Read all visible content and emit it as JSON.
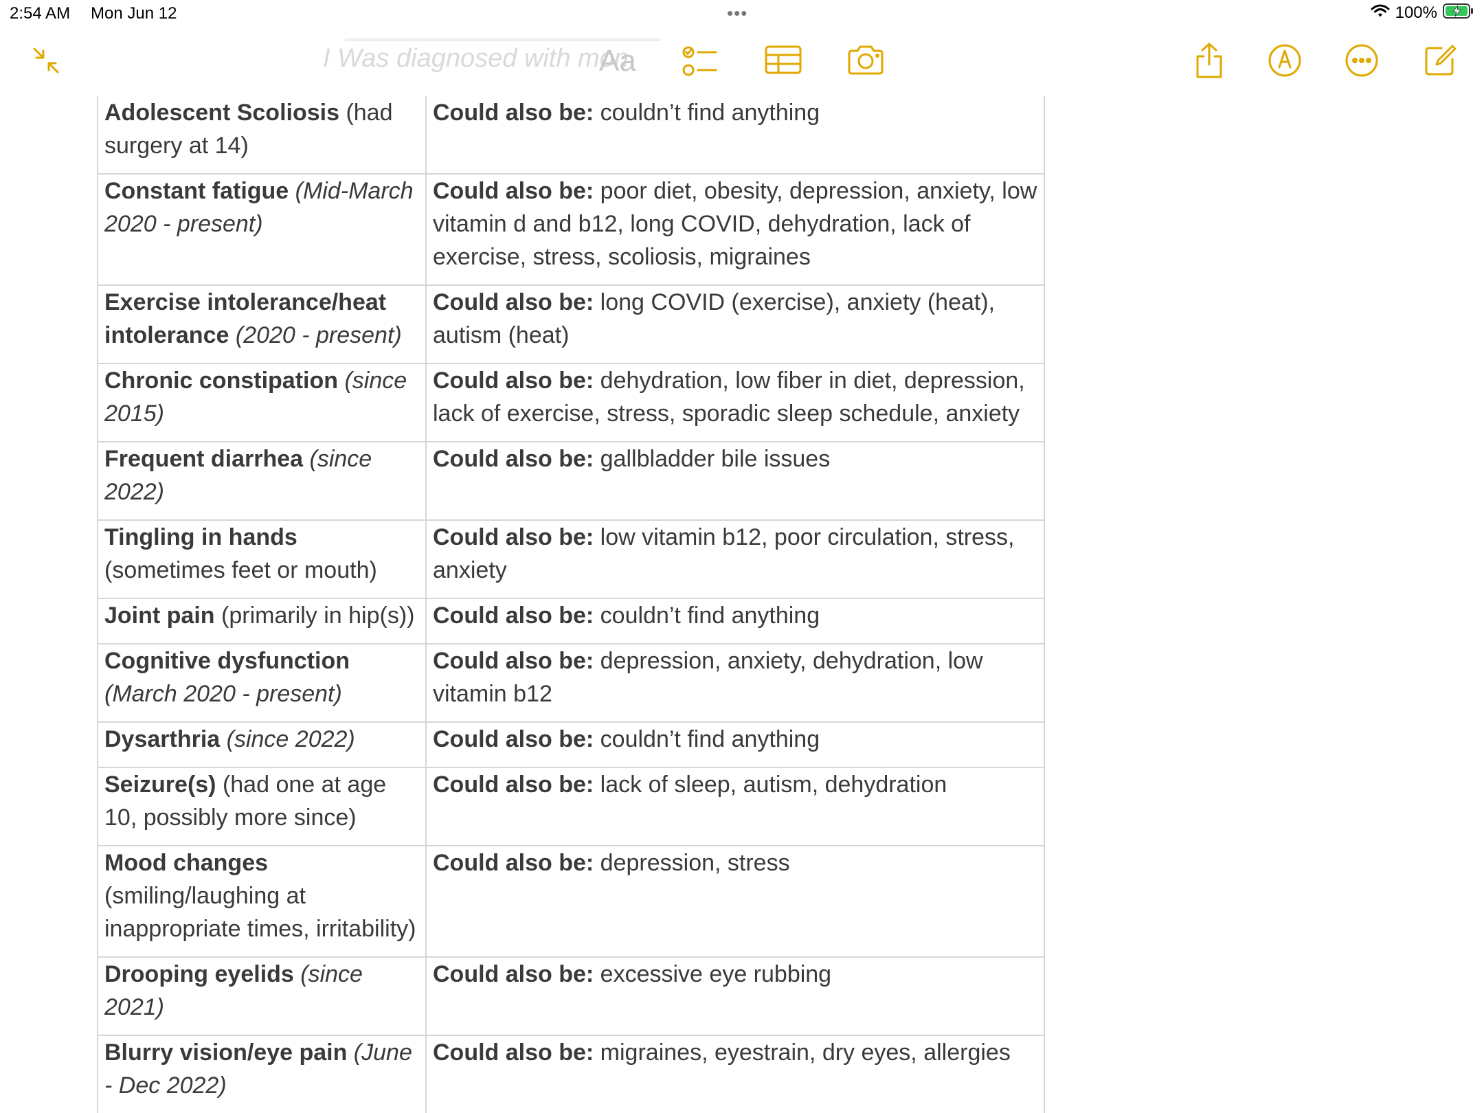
{
  "status_bar": {
    "time": "2:54 AM",
    "date": "Mon Jun 12",
    "battery": "100%"
  },
  "toolbar": {
    "ghost_title": "I Was diagnosed with mon",
    "format_label": "Aa",
    "accent_color": "#e0a800",
    "icons": [
      "collapse-icon",
      "checklist-icon",
      "table-icon",
      "camera-icon",
      "share-icon",
      "markup-icon",
      "more-icon",
      "compose-icon"
    ]
  },
  "table": {
    "label_prefix": "Could also be:",
    "rows": [
      {
        "symptom": "Adolescent Scoliosis",
        "note": " (had surgery at 14)",
        "note_italic": false,
        "alternatives": " couldn’t find anything"
      },
      {
        "symptom": "Constant fatigue",
        "note": " (Mid-March 2020 - present)",
        "note_italic": true,
        "alternatives": " poor diet, obesity, depression, anxiety, low vitamin d and b12, long COVID, dehydration, lack of exercise, stress, scoliosis, migraines"
      },
      {
        "symptom": "Exercise intolerance/heat intolerance",
        "note": " (2020 - present)",
        "note_italic": true,
        "alternatives": " long COVID (exercise), anxiety (heat), autism (heat)"
      },
      {
        "symptom": "Chronic constipation",
        "note": " (since 2015)",
        "note_italic": true,
        "alternatives": " dehydration, low fiber in diet, depression, lack of exercise, stress, sporadic sleep schedule, anxiety"
      },
      {
        "symptom": "Frequent diarrhea",
        "note": " (since 2022)",
        "note_italic": true,
        "alternatives": " gallbladder bile issues"
      },
      {
        "symptom": "Tingling in hands",
        "note": " (sometimes feet or mouth)",
        "note_italic": false,
        "alternatives": " low vitamin b12, poor circulation, stress, anxiety"
      },
      {
        "symptom": "Joint pain",
        "note": " (primarily in hip(s))",
        "note_italic": false,
        "alternatives": " couldn’t find anything"
      },
      {
        "symptom": "Cognitive dysfunction",
        "note": " (March 2020 - present)",
        "note_italic": true,
        "alternatives": " depression, anxiety, dehydration, low vitamin b12"
      },
      {
        "symptom": "Dysarthria",
        "note": " (since 2022)",
        "note_italic": true,
        "alternatives": " couldn’t find anything"
      },
      {
        "symptom": "Seizure(s)",
        "note": " (had one at age 10, possibly more since)",
        "note_italic": false,
        "alternatives": " lack of sleep, autism, dehydration"
      },
      {
        "symptom": "Mood changes",
        "note": " (smiling/laughing at inappropriate times, irritability)",
        "note_italic": false,
        "alternatives": " depression, stress"
      },
      {
        "symptom": "Drooping eyelids",
        "note": " (since 2021)",
        "note_italic": true,
        "alternatives": " excessive eye rubbing"
      },
      {
        "symptom": "Blurry vision/eye pain",
        "note": " (June - Dec 2022)",
        "note_italic": true,
        "alternatives": " migraines, eyestrain, dry eyes, allergies"
      }
    ]
  }
}
